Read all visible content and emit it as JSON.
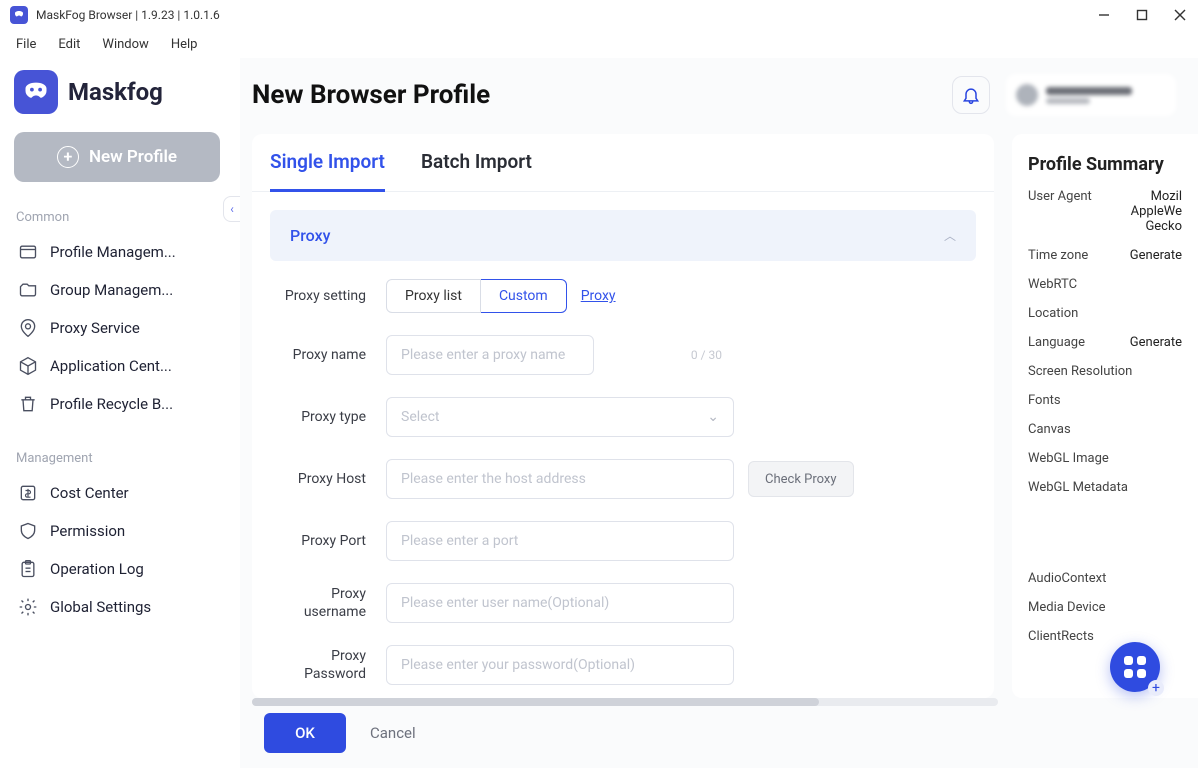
{
  "window": {
    "title": "MaskFog Browser | 1.9.23 | 1.0.1.6",
    "menu": {
      "file": "File",
      "edit": "Edit",
      "window": "Window",
      "help": "Help"
    }
  },
  "brand": {
    "name": "Maskfog"
  },
  "sidebar": {
    "new_profile": "New Profile",
    "common_label": "Common",
    "common": [
      {
        "label": "Profile Managem..."
      },
      {
        "label": "Group Managem..."
      },
      {
        "label": "Proxy Service"
      },
      {
        "label": "Application Cent..."
      },
      {
        "label": "Profile Recycle B..."
      }
    ],
    "management_label": "Management",
    "management": [
      {
        "label": "Cost Center"
      },
      {
        "label": "Permission"
      },
      {
        "label": "Operation Log"
      },
      {
        "label": "Global Settings"
      }
    ]
  },
  "page": {
    "title": "New Browser Profile",
    "tabs": {
      "single": "Single Import",
      "batch": "Batch Import"
    }
  },
  "proxy": {
    "section": "Proxy",
    "setting_label": "Proxy setting",
    "seg_list": "Proxy list",
    "seg_custom": "Custom",
    "link": "Proxy",
    "name_label": "Proxy name",
    "name_placeholder": "Please enter a proxy name",
    "name_counter": "0 / 30",
    "type_label": "Proxy type",
    "type_placeholder": "Select",
    "host_label": "Proxy Host",
    "host_placeholder": "Please enter the host address",
    "check_btn": "Check Proxy",
    "port_label": "Proxy Port",
    "port_placeholder": "Please enter a port",
    "user_label": "Proxy username",
    "user_placeholder": "Please enter user name(Optional)",
    "pass_label": "Proxy Password",
    "pass_placeholder": "Please enter your password(Optional)"
  },
  "summary": {
    "title": "Profile Summary",
    "ua_label": "User Agent",
    "ua_l1": "Mozil",
    "ua_l2": "AppleWe",
    "ua_l3": "Gecko",
    "tz_label": "Time zone",
    "tz_value": "Generate",
    "webrtc": "WebRTC",
    "location": "Location",
    "lang_label": "Language",
    "lang_value": "Generate",
    "screen": "Screen Resolution",
    "fonts": "Fonts",
    "canvas": "Canvas",
    "webgl_img": "WebGL Image",
    "webgl_meta": "WebGL Metadata",
    "audio": "AudioContext",
    "media": "Media Device",
    "rects": "ClientRects"
  },
  "footer": {
    "ok": "OK",
    "cancel": "Cancel"
  }
}
